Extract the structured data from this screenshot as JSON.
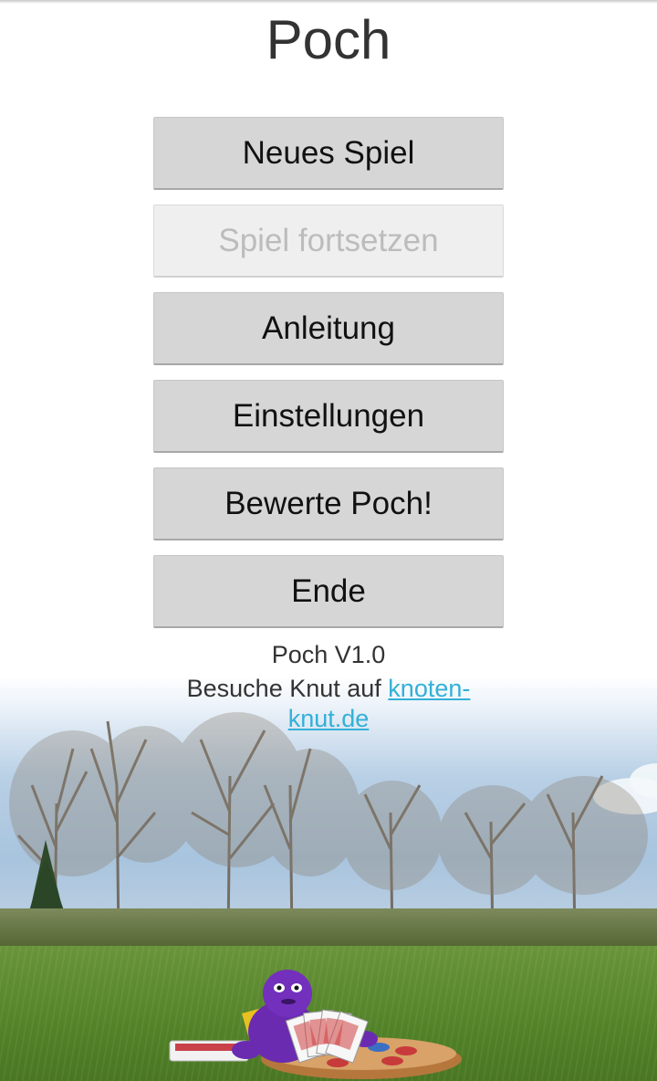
{
  "app": {
    "title": "Poch"
  },
  "menu": {
    "buttons": [
      {
        "label": "Neues Spiel",
        "enabled": true
      },
      {
        "label": "Spiel fortsetzen",
        "enabled": false
      },
      {
        "label": "Anleitung",
        "enabled": true
      },
      {
        "label": "Einstellungen",
        "enabled": true
      },
      {
        "label": "Bewerte Poch!",
        "enabled": true
      },
      {
        "label": "Ende",
        "enabled": true
      }
    ]
  },
  "footer": {
    "version": "Poch V1.0",
    "visit_prefix": "Besuche Knut auf ",
    "link_text": "knoten-knut.de"
  },
  "background": {
    "image": "park-meadow-with-purple-toy-and-cards",
    "colors": {
      "sky": "#a8c4de",
      "grass": "#5c8a2f",
      "link": "#33b0d8",
      "button": "#d6d6d6"
    }
  }
}
